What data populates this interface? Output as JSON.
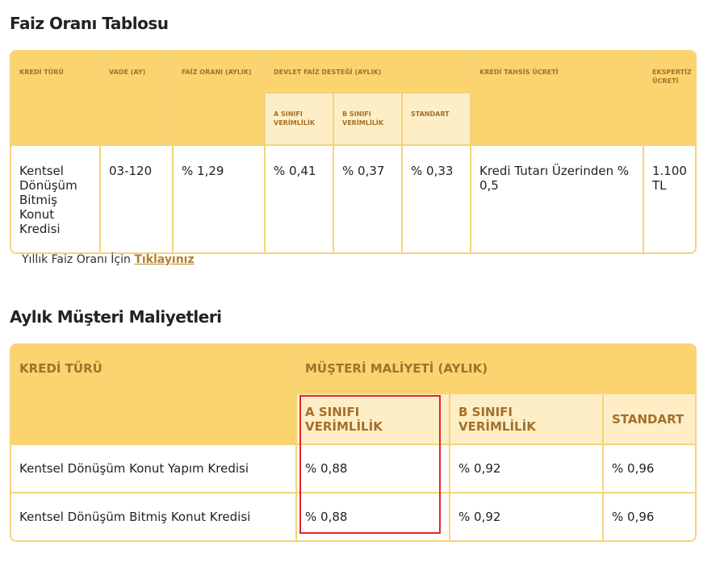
{
  "section1": {
    "title": "Faiz Oranı Tablosu",
    "headers": {
      "kredi_turu": "KREDİ TÜRÜ",
      "vade": "VADE (AY)",
      "faiz_orani": "FAİZ ORANI (AYLIK)",
      "devlet_destegi": "DEVLET FAİZ DESTEĞİ (AYLIK)",
      "a_sinifi": "A SINIFI VERİMLİLİK",
      "b_sinifi": "B SINIFI VERİMLİLİK",
      "standart": "STANDART",
      "tahsis_ucreti": "KREDİ TAHSİS ÜCRETİ",
      "ekspertiz": "EKSPERTİZ ÜCRETİ"
    },
    "row": {
      "kredi_turu": "Kentsel Dönüşüm Bitmiş Konut Kredisi",
      "vade": "03-120",
      "faiz_orani": "% 1,29",
      "a_sinifi": "% 0,41",
      "b_sinifi": "% 0,37",
      "standart": "% 0,33",
      "tahsis_ucreti": "Kredi Tutarı Üzerinden % 0,5",
      "ekspertiz": "1.100 TL"
    },
    "link_prefix": "Yıllık Faiz Oranı İçin",
    "link_label": "Tıklayınız"
  },
  "section2": {
    "title": "Aylık Müşteri Maliyetleri",
    "headers": {
      "kredi_turu": "KREDİ TÜRÜ",
      "musteri_maliyeti": "MÜŞTERİ MALİYETİ (AYLIK)",
      "a_sinifi": "A SINIFI VERİMLİLİK",
      "b_sinifi": "B SINIFI VERİMLİLİK",
      "standart": "STANDART"
    },
    "rows": [
      {
        "kredi_turu": "Kentsel Dönüşüm Konut Yapım Kredisi",
        "a": "% 0,88",
        "b": "% 0,92",
        "s": "% 0,96"
      },
      {
        "kredi_turu": "Kentsel Dönüşüm Bitmiş Konut Kredisi",
        "a": "% 0,88",
        "b": "% 0,92",
        "s": "% 0,96"
      }
    ]
  },
  "colors": {
    "header_bg": "#fbd36f",
    "subheader_bg": "#fdeec6",
    "header_text": "#a4702a",
    "border": "#f5d37a",
    "highlight": "#e0262b"
  }
}
